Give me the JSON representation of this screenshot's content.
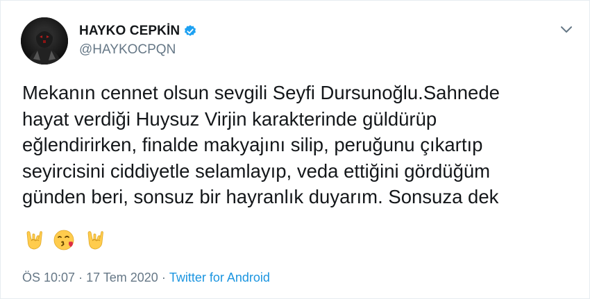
{
  "author": {
    "display_name": "HAYKO CEPKİN",
    "handle": "@HAYKOCPQN",
    "verified": true,
    "avatar_icon": "avatar-icon"
  },
  "tweet": {
    "text": "Mekanın cennet olsun sevgili Seyfi Dursunoğlu.Sahnede\nhayat verdiği Huysuz Virjin karakterinde güldürüp\neğlendirirken, finalde makyajını silip, peruğunu çıkartıp\nseyircisini ciddiyetle selamlayıp, veda ettiğini gördüğüm\ngünden beri, sonsuz bir hayranlık duyarım. Sonsuza dek",
    "emojis": [
      "sign-of-the-horns-icon",
      "face-blowing-kiss-icon",
      "sign-of-the-horns-icon"
    ]
  },
  "meta": {
    "time": "ÖS 10:07",
    "separator": "·",
    "date": "17 Tem 2020",
    "source": "Twitter for Android"
  },
  "colors": {
    "verified": "#1da1f2",
    "link": "#1b95e0",
    "secondary_text": "#657786",
    "primary_text": "#14171a"
  }
}
